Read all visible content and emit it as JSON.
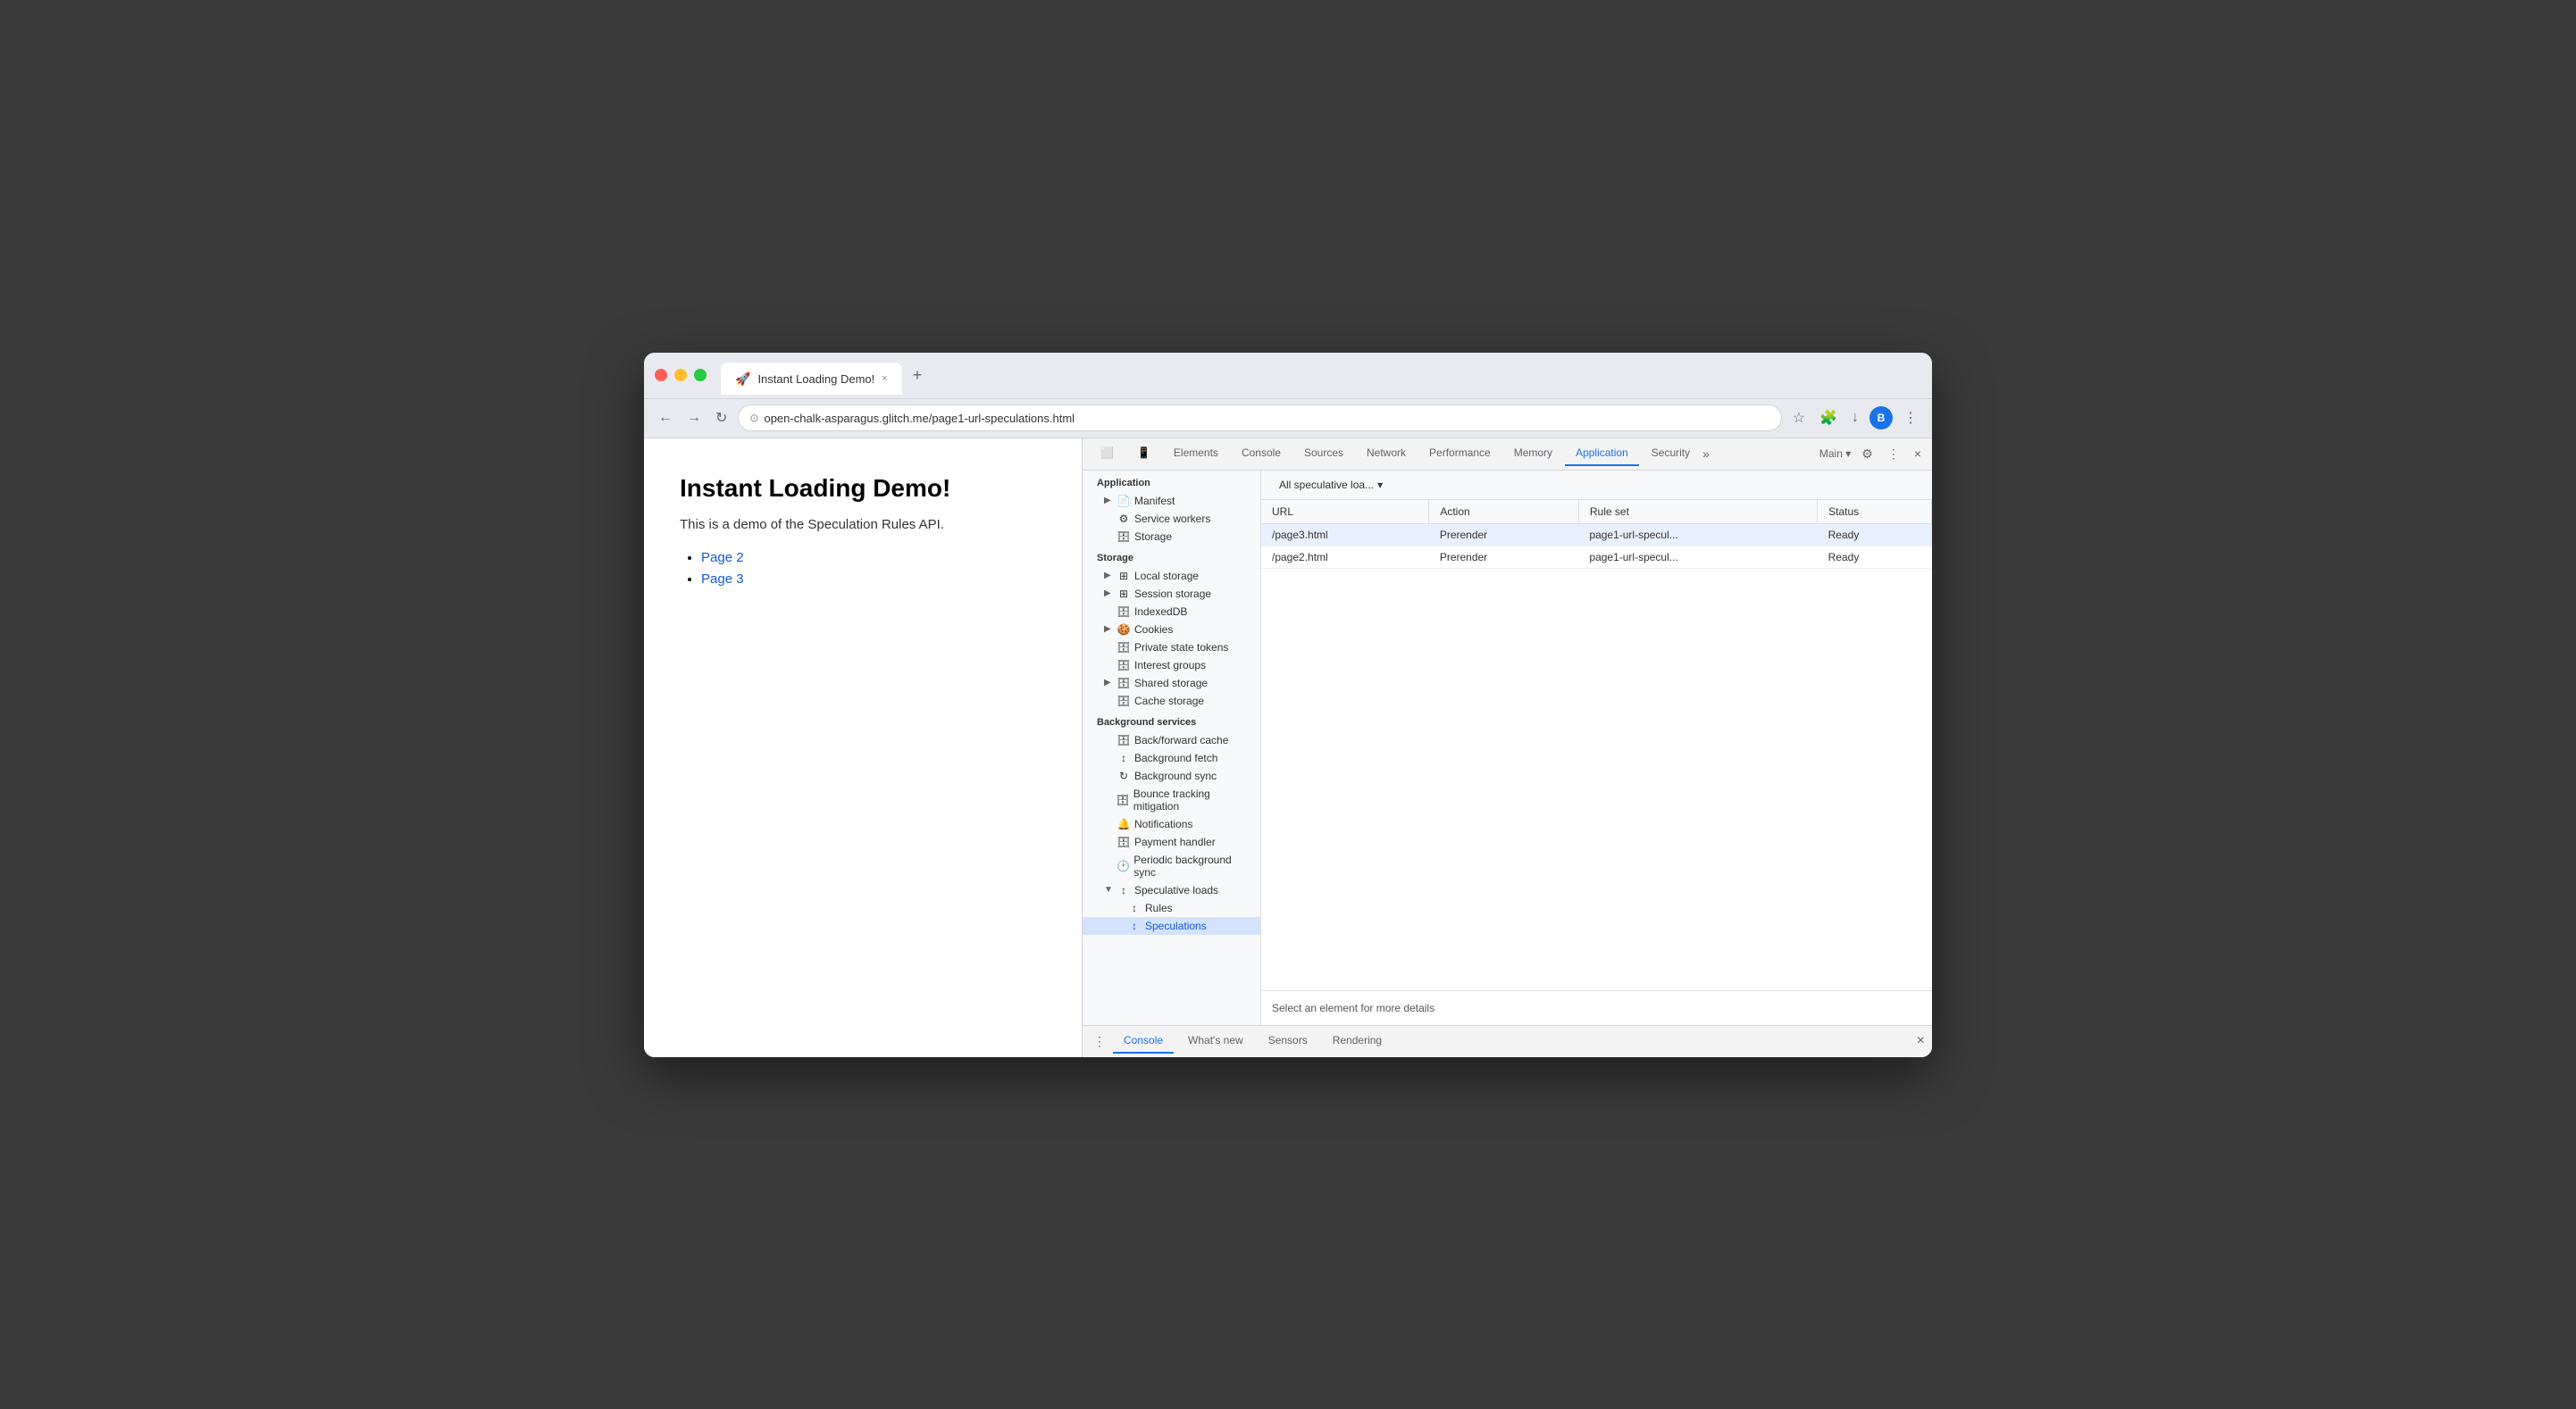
{
  "browser": {
    "tab_title": "Instant Loading Demo!",
    "tab_close": "×",
    "tab_new": "+",
    "address": "open-chalk-asparagus.glitch.me/page1-url-speculations.html",
    "nav": {
      "back": "←",
      "forward": "→",
      "reload": "↻",
      "security_icon": "⊙"
    },
    "profile_initial": "B",
    "dropdown_arrow": "▾",
    "overflow_menu": "⋮"
  },
  "page": {
    "title": "Instant Loading Demo!",
    "subtitle": "This is a demo of the Speculation Rules API.",
    "links": [
      "Page 2",
      "Page 3"
    ]
  },
  "devtools": {
    "tabs": [
      {
        "label": "Elements",
        "active": false
      },
      {
        "label": "Console",
        "active": false
      },
      {
        "label": "Sources",
        "active": false
      },
      {
        "label": "Network",
        "active": false
      },
      {
        "label": "Performance",
        "active": false
      },
      {
        "label": "Memory",
        "active": false
      },
      {
        "label": "Application",
        "active": true
      },
      {
        "label": "Security",
        "active": false
      }
    ],
    "tabs_more": "»",
    "context": "Main",
    "gear_btn": "⚙",
    "overflow_btn": "⋮",
    "close_btn": "×",
    "sidebar": {
      "application_label": "Application",
      "items": [
        {
          "label": "Manifest",
          "indent": 1,
          "icon": "📄",
          "arrow": "▶"
        },
        {
          "label": "Service workers",
          "indent": 1,
          "icon": "⚙"
        },
        {
          "label": "Storage",
          "indent": 1,
          "icon": "🗄"
        }
      ],
      "storage_label": "Storage",
      "storage_items": [
        {
          "label": "Local storage",
          "indent": 1,
          "icon": "⊞",
          "arrow": "▶"
        },
        {
          "label": "Session storage",
          "indent": 1,
          "icon": "⊞",
          "arrow": "▶"
        },
        {
          "label": "IndexedDB",
          "indent": 1,
          "icon": "🗄"
        },
        {
          "label": "Cookies",
          "indent": 1,
          "icon": "🍪",
          "arrow": "▶"
        },
        {
          "label": "Private state tokens",
          "indent": 1,
          "icon": "🗄"
        },
        {
          "label": "Interest groups",
          "indent": 1,
          "icon": "🗄"
        },
        {
          "label": "Shared storage",
          "indent": 1,
          "icon": "🗄",
          "arrow": "▶"
        },
        {
          "label": "Cache storage",
          "indent": 1,
          "icon": "🗄"
        }
      ],
      "bg_services_label": "Background services",
      "bg_items": [
        {
          "label": "Back/forward cache",
          "indent": 1,
          "icon": "🗄"
        },
        {
          "label": "Background fetch",
          "indent": 1,
          "icon": "↕"
        },
        {
          "label": "Background sync",
          "indent": 1,
          "icon": "↻"
        },
        {
          "label": "Bounce tracking mitigation",
          "indent": 1,
          "icon": "🗄"
        },
        {
          "label": "Notifications",
          "indent": 1,
          "icon": "🔔"
        },
        {
          "label": "Payment handler",
          "indent": 1,
          "icon": "🗄"
        },
        {
          "label": "Periodic background sync",
          "indent": 1,
          "icon": "🕐"
        },
        {
          "label": "Speculative loads",
          "indent": 1,
          "icon": "↕",
          "arrow": "▼"
        },
        {
          "label": "Rules",
          "indent": 2,
          "icon": "↕"
        },
        {
          "label": "Speculations",
          "indent": 2,
          "icon": "↕",
          "active": true
        }
      ]
    },
    "panel": {
      "dropdown_label": "All speculative loa...",
      "dropdown_arrow": "▾",
      "table_headers": [
        "URL",
        "Action",
        "Rule set",
        "Status"
      ],
      "rows": [
        {
          "url": "/page3.html",
          "action": "Prerender",
          "rule_set": "page1-url-specul...",
          "status": "Ready"
        },
        {
          "url": "/page2.html",
          "action": "Prerender",
          "rule_set": "page1-url-specul...",
          "status": "Ready"
        }
      ],
      "select_info": "Select an element for more details"
    },
    "bottom_tabs": [
      {
        "label": "Console",
        "active": true
      },
      {
        "label": "What's new",
        "active": false
      },
      {
        "label": "Sensors",
        "active": false
      },
      {
        "label": "Rendering",
        "active": false
      }
    ],
    "bottom_menu": "⋮",
    "bottom_close": "×"
  }
}
